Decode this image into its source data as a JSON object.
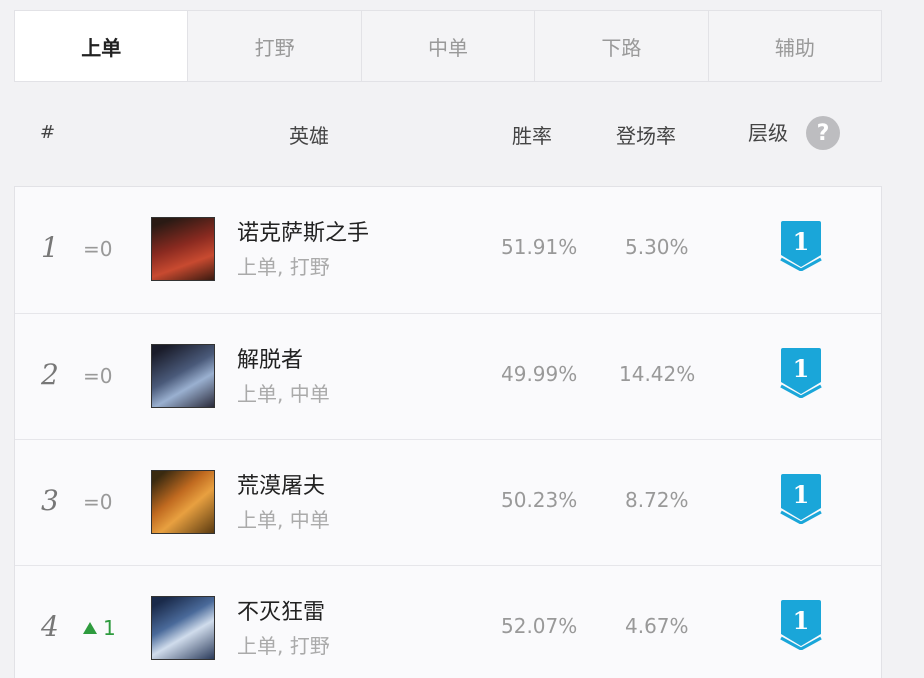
{
  "tabs": [
    {
      "label": "上单",
      "active": true
    },
    {
      "label": "打野",
      "active": false
    },
    {
      "label": "中单",
      "active": false
    },
    {
      "label": "下路",
      "active": false
    },
    {
      "label": "辅助",
      "active": false
    }
  ],
  "header": {
    "rank": "#",
    "hero": "英雄",
    "win_rate": "胜率",
    "pick_rate": "登场率",
    "tier": "层级",
    "help_icon": "?"
  },
  "rows": [
    {
      "rank": "1",
      "change": "=0",
      "trend": "same",
      "name": "诺克萨斯之手",
      "roles": "上单, 打野",
      "win_rate": "51.91%",
      "pick_rate": "5.30%",
      "tier": "1"
    },
    {
      "rank": "2",
      "change": "=0",
      "trend": "same",
      "name": "解脱者",
      "roles": "上单, 中单",
      "win_rate": "49.99%",
      "pick_rate": "14.42%",
      "tier": "1"
    },
    {
      "rank": "3",
      "change": "=0",
      "trend": "same",
      "name": "荒漠屠夫",
      "roles": "上单, 中单",
      "win_rate": "50.23%",
      "pick_rate": "8.72%",
      "tier": "1"
    },
    {
      "rank": "4",
      "change": "1",
      "trend": "up",
      "name": "不灭狂雷",
      "roles": "上单, 打野",
      "win_rate": "52.07%",
      "pick_rate": "4.67%",
      "tier": "1"
    }
  ],
  "colors": {
    "tier_badge": "#1aa6d9",
    "trend_up": "#2e9b3e"
  }
}
